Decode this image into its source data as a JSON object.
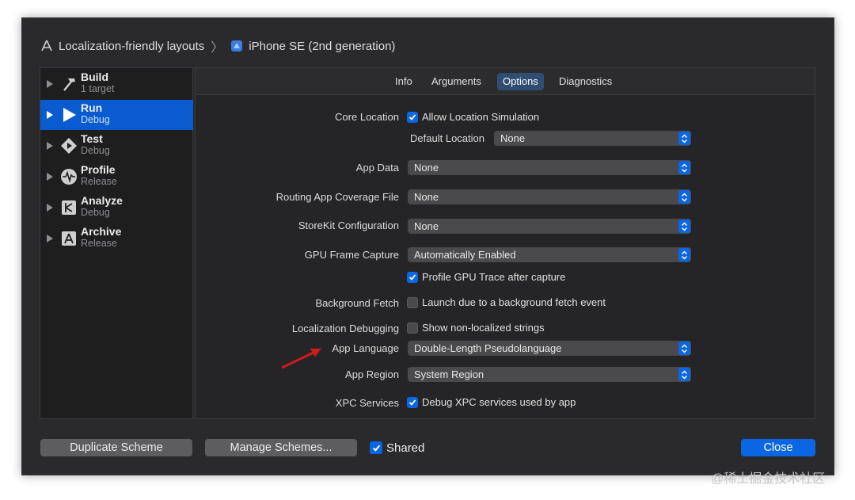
{
  "title": {
    "project": "Localization-friendly layouts",
    "separator": "〉",
    "device": "iPhone SE (2nd generation)"
  },
  "sidebar": {
    "items": [
      {
        "title": "Build",
        "sub": "1 target",
        "icon": "hammer-icon"
      },
      {
        "title": "Run",
        "sub": "Debug",
        "icon": "play-icon"
      },
      {
        "title": "Test",
        "sub": "Debug",
        "icon": "diamond-play-icon"
      },
      {
        "title": "Profile",
        "sub": "Release",
        "icon": "waveform-icon"
      },
      {
        "title": "Analyze",
        "sub": "Debug",
        "icon": "analyze-icon"
      },
      {
        "title": "Archive",
        "sub": "Release",
        "icon": "archive-icon"
      }
    ],
    "active_index": 1
  },
  "tabs": [
    "Info",
    "Arguments",
    "Options",
    "Diagnostics"
  ],
  "selected_tab": "Options",
  "options": {
    "core_location_label": "Core Location",
    "allow_location_simulation": "Allow Location Simulation",
    "default_location_label": "Default Location",
    "default_location_value": "None",
    "app_data_label": "App Data",
    "app_data_value": "None",
    "routing_label": "Routing App Coverage File",
    "routing_value": "None",
    "storekit_label": "StoreKit Configuration",
    "storekit_value": "None",
    "gpu_label": "GPU Frame Capture",
    "gpu_value": "Automatically Enabled",
    "profile_gpu": "Profile GPU Trace after capture",
    "bg_fetch_label": "Background Fetch",
    "bg_fetch_check": "Launch due to a background fetch event",
    "loc_debug_label": "Localization Debugging",
    "loc_debug_check": "Show non-localized strings",
    "app_language_label": "App Language",
    "app_language_value": "Double-Length Pseudolanguage",
    "app_region_label": "App Region",
    "app_region_value": "System Region",
    "xpc_label": "XPC Services",
    "xpc_check": "Debug XPC services used by app"
  },
  "footer": {
    "duplicate": "Duplicate Scheme",
    "manage": "Manage Schemes...",
    "shared": "Shared",
    "close": "Close"
  },
  "watermark": "@稀土掘金技术社区",
  "colors": {
    "accent": "#0a66e3",
    "sidebar_selected": "#0a5bd0",
    "annotation_arrow": "#d21a1a"
  }
}
